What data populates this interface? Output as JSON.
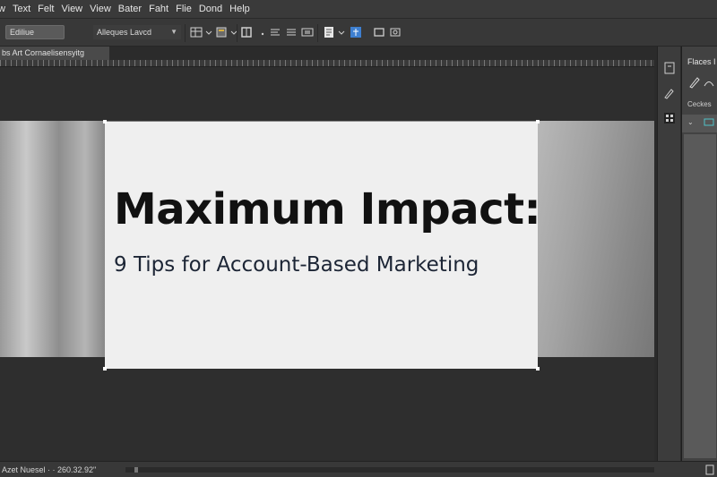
{
  "menubar": {
    "items": [
      "w",
      "Text",
      "Felt",
      "View",
      "View",
      "Bater",
      "Faht",
      "Flie",
      "Dond",
      "Help"
    ]
  },
  "optionsbar": {
    "preset_label": "Ediliue",
    "font_dropdown": {
      "value": "Alleques Lavcd"
    }
  },
  "document": {
    "tab_title": "bs Art Cornaelisensyitg",
    "headline": "Maximum Impact:",
    "subheadline": "9 Tips for Account-Based Marketing"
  },
  "right_panel": {
    "title": "Flaces I",
    "label": "Ceckes"
  },
  "statusbar": {
    "text": "Azet Nuesel  · ·  260.32.92\""
  }
}
